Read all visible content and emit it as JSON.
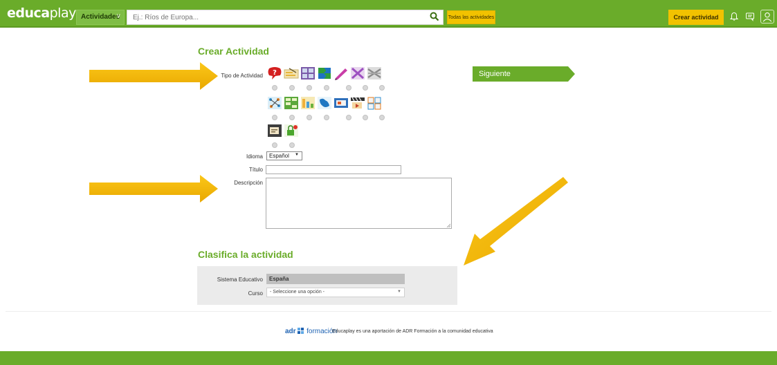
{
  "header": {
    "logo_bold": "educa",
    "logo_thin": "play",
    "category_button": "Actividades",
    "search_placeholder": "Ej.: Ríos de Europa...",
    "all_activities": "Todas las actividades",
    "create_activity": "Crear actividad"
  },
  "form": {
    "title": "Crear Actividad",
    "type_label": "Tipo de Actividad",
    "language_label": "Idioma",
    "language_value": "Español",
    "title_label": "Título",
    "description_label": "Descripción",
    "next_button": "Siguiente",
    "activity_icons": [
      "quiz-icon",
      "crossword-icon",
      "alphabet-icon",
      "puzzle-icon",
      "dictation-icon",
      "wordsearch-icon",
      "matching-icon",
      "relate-icon",
      "columns-icon",
      "classification-icon",
      "map-icon",
      "slides-icon",
      "video-quiz-icon",
      "memory-icon",
      "dialogue-icon",
      "lock-icon"
    ]
  },
  "classify": {
    "title": "Clasifica la actividad",
    "system_label": "Sistema Educativo",
    "system_value": "España",
    "course_label": "Curso",
    "course_placeholder": "- Seleccione una opción -"
  },
  "footer": {
    "logo_adr": "adr",
    "logo_formacion": "formación",
    "text": "Educaplay es una aportación de ADR Formación a la comunidad educativa"
  },
  "colors": {
    "brand_green": "#6aac2a",
    "accent_yellow": "#f2c200",
    "arrow_yellow": "#f5b800"
  }
}
